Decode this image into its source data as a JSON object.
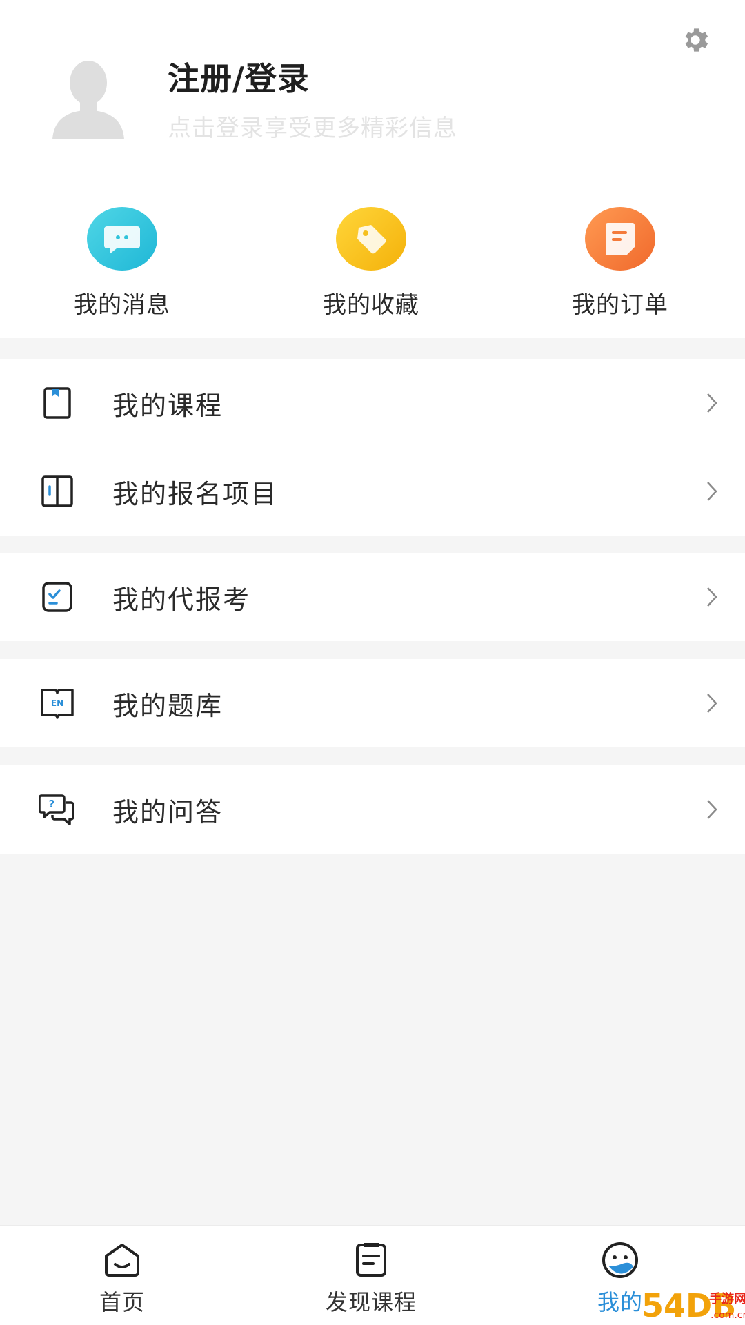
{
  "profile": {
    "login_title": "注册/登录",
    "login_subtitle": "点击登录享受更多精彩信息",
    "avatar_icon": "default-avatar-icon",
    "settings_icon": "gear-icon"
  },
  "quick_entries": [
    {
      "label": "我的消息",
      "icon": "message-icon",
      "color": "#35c9dc"
    },
    {
      "label": "我的收藏",
      "icon": "tag-icon",
      "color": "#f7c21c"
    },
    {
      "label": "我的订单",
      "icon": "order-icon",
      "color": "#f6823c"
    }
  ],
  "menu": [
    {
      "label": "我的课程",
      "icon": "course-book-icon"
    },
    {
      "label": "我的报名项目",
      "icon": "open-book-icon"
    },
    {
      "label": "我的代报考",
      "icon": "checklist-icon"
    },
    {
      "label": "我的题库",
      "icon": "question-bank-icon"
    },
    {
      "label": "我的问答",
      "icon": "qa-chat-icon"
    }
  ],
  "tabbar": {
    "items": [
      {
        "label": "首页",
        "icon": "home-icon",
        "active": false
      },
      {
        "label": "发现课程",
        "icon": "discover-course-icon",
        "active": false
      },
      {
        "label": "我的",
        "icon": "profile-face-icon",
        "active": true
      }
    ],
    "active_color": "#2b8fd8"
  },
  "watermark": {
    "brand": "54DB",
    "text": "手游网",
    "domain": ".com.cn"
  }
}
